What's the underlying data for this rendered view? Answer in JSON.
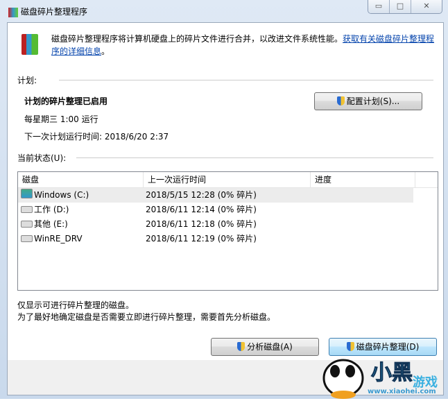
{
  "window": {
    "title": "磁盘碎片整理程序",
    "controls": [
      "▭",
      "□",
      "✕"
    ]
  },
  "description": {
    "text": "磁盘碎片整理程序将计算机硬盘上的碎片文件进行合并，以改进文件系统性能。",
    "link": "获取有关磁盘碎片整理程序的详细信息",
    "end": "。"
  },
  "schedule": {
    "heading": "计划:",
    "status": "计划的碎片整理已启用",
    "frequency": "每星期三 1:00 运行",
    "next_run": "下一次计划运行时间: 2018/6/20 2:37",
    "configure_button": "配置计划(S)..."
  },
  "current": {
    "heading": "当前状态(U):",
    "columns": [
      "磁盘",
      "上一次运行时间",
      "进度"
    ],
    "rows": [
      {
        "disk": "Windows (C:)",
        "last_run": "2018/5/15 12:28 (0% 碎片)",
        "progress": "",
        "system": true
      },
      {
        "disk": "工作 (D:)",
        "last_run": "2018/6/11 12:14 (0% 碎片)",
        "progress": ""
      },
      {
        "disk": "其他 (E:)",
        "last_run": "2018/6/11 12:18 (0% 碎片)",
        "progress": ""
      },
      {
        "disk": "WinRE_DRV",
        "last_run": "2018/6/11 12:19 (0% 碎片)",
        "progress": ""
      }
    ]
  },
  "notes": [
    "仅显示可进行碎片整理的磁盘。",
    "为了最好地确定磁盘是否需要立即进行碎片整理，需要首先分析磁盘。"
  ],
  "buttons": {
    "analyze": "分析磁盘(A)",
    "defragment": "磁盘碎片整理(D)"
  },
  "watermark": {
    "brand": "小黑游戏",
    "url": "www.xiaohei.com"
  }
}
